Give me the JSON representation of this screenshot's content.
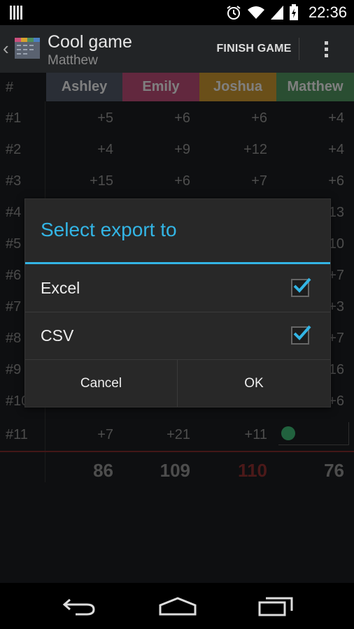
{
  "status_bar": {
    "time": "22:36"
  },
  "action_bar": {
    "title": "Cool game",
    "subtitle": "Matthew",
    "finish_label": "FINISH GAME"
  },
  "table": {
    "hash_header": "#",
    "players": [
      {
        "name": "Ashley",
        "color": "#4e5563"
      },
      {
        "name": "Emily",
        "color": "#b34a71"
      },
      {
        "name": "Joshua",
        "color": "#c1902e"
      },
      {
        "name": "Matthew",
        "color": "#4e8f5c"
      }
    ],
    "rows": [
      {
        "label": "#1",
        "scores": [
          "+5",
          "+6",
          "+6",
          "+4"
        ]
      },
      {
        "label": "#2",
        "scores": [
          "+4",
          "+9",
          "+12",
          "+4"
        ]
      },
      {
        "label": "#3",
        "scores": [
          "+15",
          "+6",
          "+7",
          "+6"
        ]
      },
      {
        "label": "#4",
        "scores": [
          "",
          "",
          "",
          "13"
        ]
      },
      {
        "label": "#5",
        "scores": [
          "",
          "",
          "",
          "10"
        ]
      },
      {
        "label": "#6",
        "scores": [
          "",
          "",
          "",
          "+7"
        ]
      },
      {
        "label": "#7",
        "scores": [
          "",
          "",
          "",
          "+3"
        ]
      },
      {
        "label": "#8",
        "scores": [
          "",
          "",
          "",
          "+7"
        ]
      },
      {
        "label": "#9",
        "scores": [
          "",
          "",
          "",
          "16"
        ]
      },
      {
        "label": "#10",
        "scores": [
          "",
          "",
          "",
          "+6"
        ]
      },
      {
        "label": "#11",
        "scores": [
          "+7",
          "+21",
          "+11",
          ""
        ]
      }
    ],
    "totals": [
      "86",
      "109",
      "110",
      "76"
    ],
    "leader_color": "#8b2f2f"
  },
  "dialog": {
    "title": "Select export to",
    "options": [
      {
        "label": "Excel",
        "checked": true
      },
      {
        "label": "CSV",
        "checked": true
      }
    ],
    "cancel_label": "Cancel",
    "ok_label": "OK",
    "accent": "#33b5e5"
  }
}
